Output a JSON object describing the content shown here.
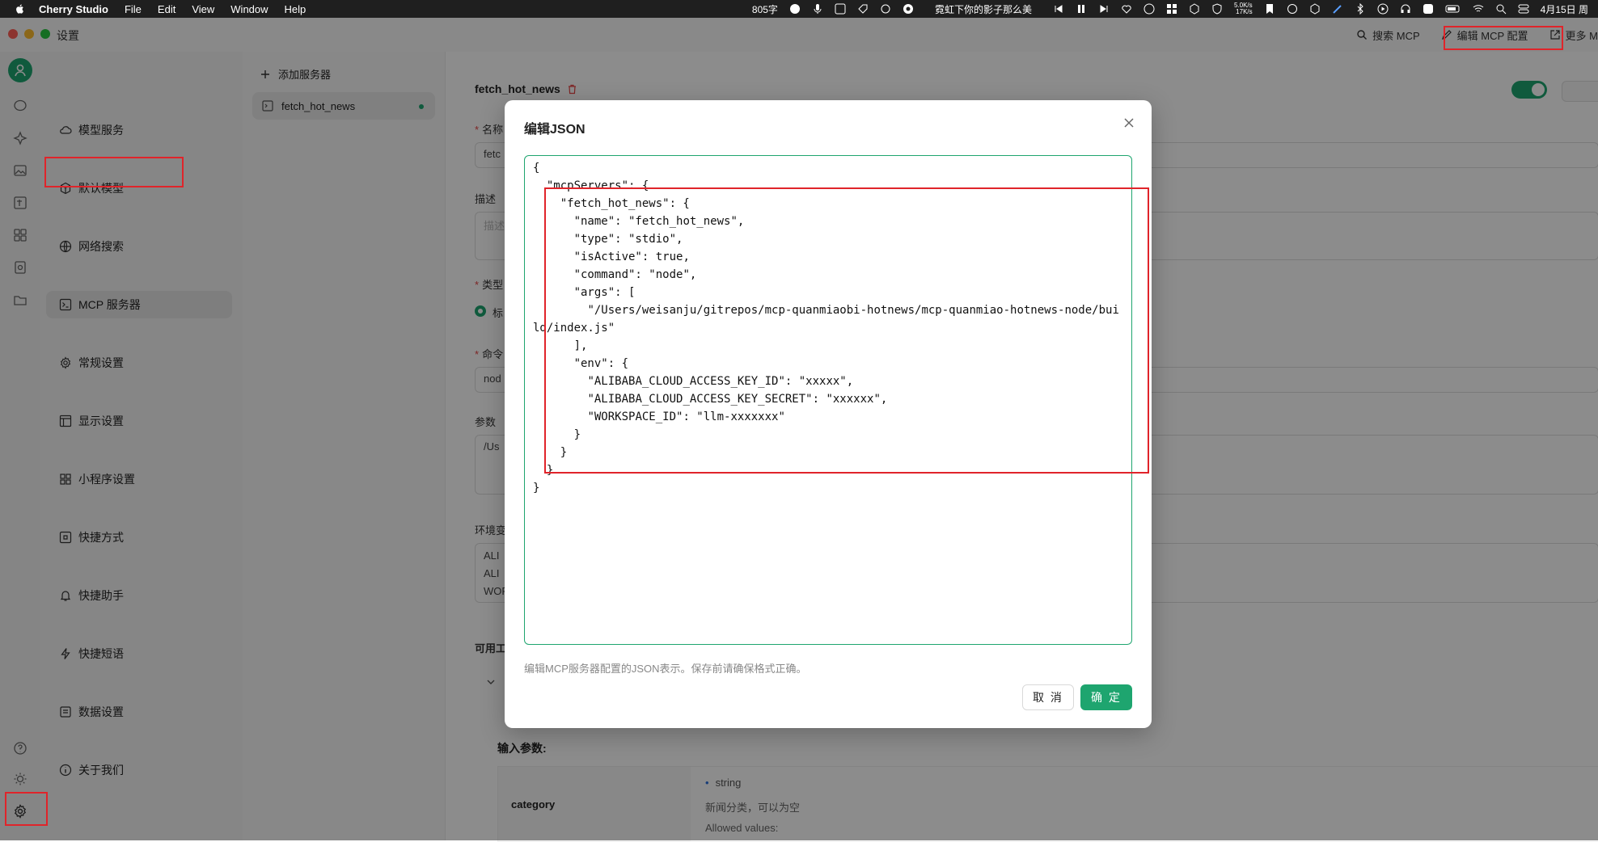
{
  "menubar": {
    "app_name": "Cherry Studio",
    "menus": [
      "File",
      "Edit",
      "View",
      "Window",
      "Help"
    ],
    "word_count": "805字",
    "now_playing": "霓虹下你的影子那么美",
    "net_up": "5.0K/s",
    "net_down": "17K/s",
    "clock": "4月15日 周"
  },
  "window": {
    "title": "设置",
    "search_mcp": "搜索 MCP",
    "edit_mcp_config": "编辑 MCP 配置",
    "more": "更多 M"
  },
  "settings_nav": {
    "items": [
      {
        "label": "模型服务",
        "icon": "cloud-icon"
      },
      {
        "label": "默认模型",
        "icon": "cube-icon"
      },
      {
        "label": "网络搜索",
        "icon": "globe-icon"
      },
      {
        "label": "MCP 服务器",
        "icon": "terminal-icon"
      },
      {
        "label": "常规设置",
        "icon": "gear-icon"
      },
      {
        "label": "显示设置",
        "icon": "layout-icon"
      },
      {
        "label": "小程序设置",
        "icon": "grid-icon"
      },
      {
        "label": "快捷方式",
        "icon": "command-icon"
      },
      {
        "label": "快捷助手",
        "icon": "bell-icon"
      },
      {
        "label": "快捷短语",
        "icon": "zap-icon"
      },
      {
        "label": "数据设置",
        "icon": "database-icon"
      },
      {
        "label": "关于我们",
        "icon": "info-icon"
      }
    ],
    "active_index": 3
  },
  "server_list": {
    "add_label": "添加服务器",
    "servers": [
      {
        "name": "fetch_hot_news",
        "active": true
      }
    ]
  },
  "detail": {
    "server_name": "fetch_hot_news",
    "name_label": "名称",
    "name_value": "fetc",
    "desc_label": "描述",
    "desc_placeholder": "描述",
    "type_label": "类型",
    "type_value": "标",
    "command_label": "命令",
    "command_value": "nod",
    "args_label": "参数",
    "args_value": "/Us",
    "env_label": "环境变",
    "env_values": [
      "ALI",
      "ALI",
      "WOR"
    ],
    "tools_label": "可用工",
    "params_title": "输入参数:",
    "param_name": "category",
    "param_type": "string",
    "param_desc": "新闻分类，可以为空",
    "param_allowed": "Allowed values:"
  },
  "modal": {
    "title": "编辑JSON",
    "json_text": "{\n  \"mcpServers\": {\n    \"fetch_hot_news\": {\n      \"name\": \"fetch_hot_news\",\n      \"type\": \"stdio\",\n      \"isActive\": true,\n      \"command\": \"node\",\n      \"args\": [\n        \"/Users/weisanju/gitrepos/mcp-quanmiaobi-hotnews/mcp-quanmiao-hotnews-node/build/index.js\"\n      ],\n      \"env\": {\n        \"ALIBABA_CLOUD_ACCESS_KEY_ID\": \"xxxxx\",\n        \"ALIBABA_CLOUD_ACCESS_KEY_SECRET\": \"xxxxxx\",\n        \"WORKSPACE_ID\": \"llm-xxxxxxx\"\n      }\n    }\n  }\n}",
    "hint": "编辑MCP服务器配置的JSON表示。保存前请确保格式正确。",
    "cancel_label": "取 消",
    "ok_label": "确 定"
  },
  "colors": {
    "accent": "#1ea56f",
    "highlight": "#e0242a"
  }
}
